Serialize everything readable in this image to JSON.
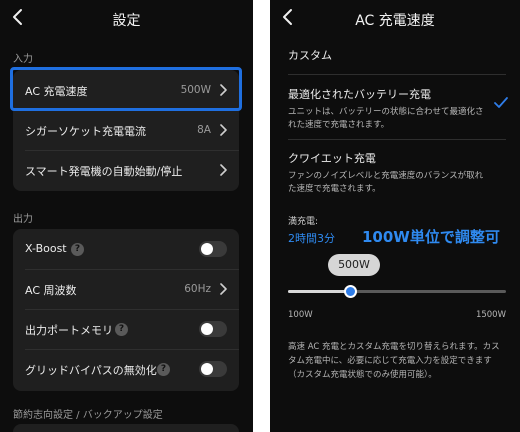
{
  "left": {
    "title": "設定",
    "sections": {
      "input": "入力",
      "output": "出力",
      "saving": "節約志向設定 / バックアップ設定"
    },
    "input_rows": [
      {
        "label": "AC 充電速度",
        "value": "500W"
      },
      {
        "label": "シガーソケット充電電流",
        "value": "8A"
      },
      {
        "label": "スマート発電機の自動始動/停止",
        "value": ""
      }
    ],
    "output_rows": [
      {
        "label": "X-Boost",
        "value": "",
        "help": "?",
        "toggle_on": false
      },
      {
        "label": "AC 周波数",
        "value": "60Hz"
      },
      {
        "label": "出力ポートメモリ",
        "value": "",
        "help": "?",
        "toggle_on": false
      },
      {
        "label": "グリッドバイパスの無効化",
        "value": "",
        "help": "?",
        "toggle_on": false
      }
    ]
  },
  "right": {
    "title": "AC 充電速度",
    "custom_label": "カスタム",
    "options": [
      {
        "title": "最適化されたバッテリー充電",
        "desc": "ユニットは、バッテリーの状態に合わせて最適化された速度で充電されます。",
        "selected": true
      },
      {
        "title": "クワイエット充電",
        "desc": "ファンのノイズレベルと充電速度のバランスが取れた速度で充電されます。",
        "selected": false
      }
    ],
    "full_charge_label": "満充電:",
    "full_charge_time": "2時間3分",
    "annotation": "100W単位で調整可",
    "slider": {
      "value_label": "500W",
      "min_label": "100W",
      "max_label": "1500W",
      "value": 500,
      "min": 100,
      "max": 1500
    },
    "footer": "高速 AC 充電とカスタム充電を切り替えられます。カスタム充電中に、必要に応じて充電入力を設定できます（カスタム充電状態でのみ使用可能）。"
  },
  "colors": {
    "accent": "#2f7de8",
    "highlight_border": "#1f6fe0",
    "background": "#0d0d0d",
    "card": "#1f1f1f"
  },
  "icons": {
    "back": "chevron-left-icon",
    "row": "chevron-right-icon",
    "help": "help-circle-icon",
    "check": "check-icon"
  }
}
